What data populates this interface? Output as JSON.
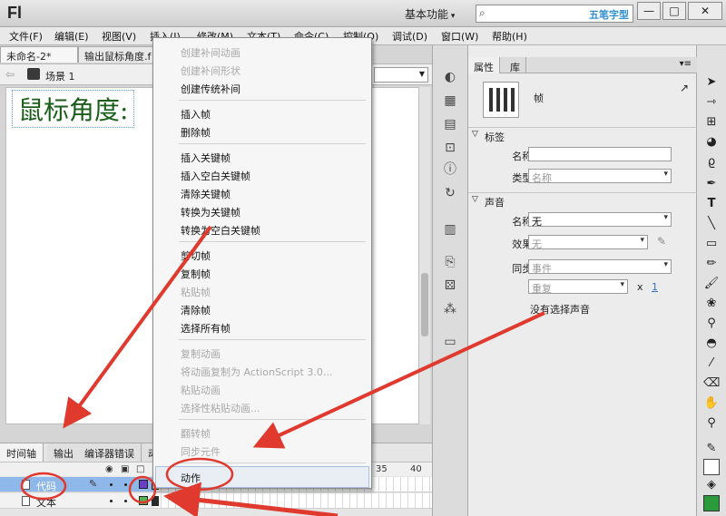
{
  "titlebar": {
    "app_logo": "Fl",
    "workspace": "基本功能",
    "watermark": "五笔字型",
    "minimize": "—",
    "maximize": "□",
    "close": "✕"
  },
  "menubar": [
    "文件(F)",
    "编辑(E)",
    "视图(V)",
    "插入(I)",
    "修改(M)",
    "文本(T)",
    "命令(C)",
    "控制(O)",
    "调试(D)",
    "窗口(W)",
    "帮助(H)"
  ],
  "doc_tabs": [
    "未命名-2*",
    "输出鼠标角度.f"
  ],
  "edit_bar": {
    "scene": "场景 1"
  },
  "stage": {
    "text": "鼠标角度:"
  },
  "context_menu": {
    "items": [
      {
        "label": "创建补间动画",
        "disabled": true
      },
      {
        "label": "创建补间形状",
        "disabled": true
      },
      {
        "label": "创建传统补间",
        "disabled": false
      },
      {
        "label": "插入帧",
        "disabled": false
      },
      {
        "label": "删除帧",
        "disabled": false
      },
      {
        "label": "插入关键帧",
        "disabled": false
      },
      {
        "label": "插入空白关键帧",
        "disabled": false
      },
      {
        "label": "清除关键帧",
        "disabled": false
      },
      {
        "label": "转换为关键帧",
        "disabled": false
      },
      {
        "label": "转换为空白关键帧",
        "disabled": false
      },
      {
        "label": "剪切帧",
        "disabled": false
      },
      {
        "label": "复制帧",
        "disabled": false
      },
      {
        "label": "粘贴帧",
        "disabled": true
      },
      {
        "label": "清除帧",
        "disabled": false
      },
      {
        "label": "选择所有帧",
        "disabled": false
      },
      {
        "label": "复制动画",
        "disabled": true
      },
      {
        "label": "将动画复制为 ActionScript 3.0...",
        "disabled": true
      },
      {
        "label": "粘贴动画",
        "disabled": true
      },
      {
        "label": "选择性粘贴动画...",
        "disabled": true
      },
      {
        "label": "翻转帧",
        "disabled": true
      },
      {
        "label": "同步元件",
        "disabled": true
      },
      {
        "label": "动作",
        "disabled": false,
        "highlighted": true
      }
    ]
  },
  "timeline": {
    "tabs": [
      "时间轴",
      "输出",
      "编译器错误",
      "动"
    ],
    "frame_numbers": [
      "35",
      "40"
    ],
    "layers": [
      {
        "name": "代码",
        "selected": true,
        "keyframe_color": "#6a3fc8"
      },
      {
        "name": "文本",
        "selected": false,
        "keyframe_color": "#5ab050"
      }
    ]
  },
  "properties": {
    "tabs": [
      "属性",
      "库"
    ],
    "frame_type": "帧",
    "label_section": "标签",
    "name_label": "名称:",
    "name_value": "",
    "type_label": "类型:",
    "type_value": "名称",
    "sound_section": "声音",
    "sound_name_label": "名称:",
    "sound_name_value": "无",
    "effect_label": "效果:",
    "effect_value": "无",
    "sync_label": "同步:",
    "sync_value": "事件",
    "repeat_value": "重复",
    "repeat_times_symbol": "x",
    "repeat_count": "1",
    "no_sound_msg": "没有选择声音"
  },
  "colors": {
    "annotation_red": "#e03a2f",
    "selected_layer": "#8fb8ea",
    "stage_text": "#1a5e1a"
  }
}
